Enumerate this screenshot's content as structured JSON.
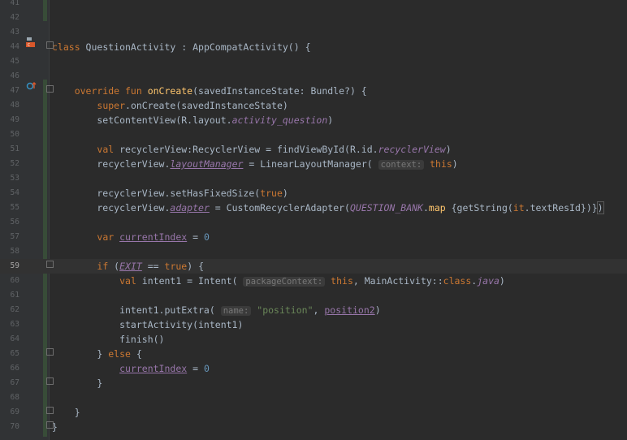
{
  "editor": {
    "lines": [
      {
        "n": "41",
        "tokens": []
      },
      {
        "n": "42",
        "tokens": []
      },
      {
        "n": "43",
        "tokens": []
      },
      {
        "n": "44",
        "tokens": [
          {
            "t": "class",
            "c": "kw"
          },
          {
            "t": " QuestionActivity : AppCompatActivity() {"
          }
        ]
      },
      {
        "n": "45",
        "tokens": []
      },
      {
        "n": "46",
        "tokens": []
      },
      {
        "n": "47",
        "tokens": [
          {
            "t": "    override fun ",
            "c": "kw"
          },
          {
            "t": "onCreate",
            "c": "fn"
          },
          {
            "t": "(savedInstanceState: Bundle?) {"
          }
        ]
      },
      {
        "n": "48",
        "tokens": [
          {
            "t": "        "
          },
          {
            "t": "super",
            "c": "kw"
          },
          {
            "t": ".onCreate(savedInstanceState)"
          }
        ]
      },
      {
        "n": "49",
        "tokens": [
          {
            "t": "        setContentView(R.layout."
          },
          {
            "t": "activity_question",
            "c": "pp"
          },
          {
            "t": ")"
          }
        ]
      },
      {
        "n": "50",
        "tokens": []
      },
      {
        "n": "51",
        "tokens": [
          {
            "t": "        "
          },
          {
            "t": "val ",
            "c": "kw"
          },
          {
            "t": "recyclerView:RecyclerView = findViewById(R.id."
          },
          {
            "t": "recyclerView",
            "c": "pp"
          },
          {
            "t": ")"
          }
        ]
      },
      {
        "n": "52",
        "tokens": [
          {
            "t": "        recyclerView."
          },
          {
            "t": "layoutManager",
            "c": "ppu"
          },
          {
            "t": " = LinearLayoutManager( "
          },
          {
            "t": "context:",
            "c": "hint"
          },
          {
            "t": " this",
            "c": "kw"
          },
          {
            "t": ")"
          }
        ]
      },
      {
        "n": "53",
        "tokens": []
      },
      {
        "n": "54",
        "tokens": [
          {
            "t": "        recyclerView.setHasFixedSize("
          },
          {
            "t": "true",
            "c": "kw"
          },
          {
            "t": ")"
          }
        ]
      },
      {
        "n": "55",
        "tokens": [
          {
            "t": "        recyclerView."
          },
          {
            "t": "adapter",
            "c": "ppu"
          },
          {
            "t": " = CustomRecyclerAdapter("
          },
          {
            "t": "QUESTION_BANK",
            "c": "pp"
          },
          {
            "t": "."
          },
          {
            "t": "map",
            "c": "fn"
          },
          {
            "t": " {getString("
          },
          {
            "t": "it",
            "c": "kw"
          },
          {
            "t": ".textResId})}"
          },
          {
            "t": ")",
            "c": "boxp"
          }
        ]
      },
      {
        "n": "56",
        "tokens": []
      },
      {
        "n": "57",
        "tokens": [
          {
            "t": "        "
          },
          {
            "t": "var ",
            "c": "kw"
          },
          {
            "t": "currentIndex",
            "c": "vu"
          },
          {
            "t": " = "
          },
          {
            "t": "0",
            "c": "num"
          }
        ]
      },
      {
        "n": "58",
        "tokens": []
      },
      {
        "n": "59",
        "tokens": [
          {
            "t": "        "
          },
          {
            "t": "if ",
            "c": "kw"
          },
          {
            "t": "("
          },
          {
            "t": "EXIT",
            "c": "ppu"
          },
          {
            "t": " == "
          },
          {
            "t": "true",
            "c": "kw"
          },
          {
            "t": ") {"
          }
        ],
        "current": true
      },
      {
        "n": "60",
        "tokens": [
          {
            "t": "            "
          },
          {
            "t": "val ",
            "c": "kw"
          },
          {
            "t": "intent1 = Intent( "
          },
          {
            "t": "packageContext:",
            "c": "hint"
          },
          {
            "t": " this",
            "c": "kw"
          },
          {
            "t": ", MainActivity::"
          },
          {
            "t": "class",
            "c": "kw"
          },
          {
            "t": "."
          },
          {
            "t": "java",
            "c": "pp"
          },
          {
            "t": ")"
          }
        ]
      },
      {
        "n": "61",
        "tokens": []
      },
      {
        "n": "62",
        "tokens": [
          {
            "t": "            intent1.putExtra( "
          },
          {
            "t": "name:",
            "c": "hint"
          },
          {
            "t": " "
          },
          {
            "t": "\"position\"",
            "c": "str"
          },
          {
            "t": ", "
          },
          {
            "t": "position2",
            "c": "vu"
          },
          {
            "t": ")"
          }
        ]
      },
      {
        "n": "63",
        "tokens": [
          {
            "t": "            startActivity(intent1)"
          }
        ]
      },
      {
        "n": "64",
        "tokens": [
          {
            "t": "            finish()"
          }
        ]
      },
      {
        "n": "65",
        "tokens": [
          {
            "t": "        } "
          },
          {
            "t": "else",
            "c": "kw"
          },
          {
            "t": " {"
          }
        ]
      },
      {
        "n": "66",
        "tokens": [
          {
            "t": "            "
          },
          {
            "t": "currentIndex",
            "c": "vu"
          },
          {
            "t": " = "
          },
          {
            "t": "0",
            "c": "num"
          }
        ]
      },
      {
        "n": "67",
        "tokens": [
          {
            "t": "        }"
          }
        ]
      },
      {
        "n": "68",
        "tokens": []
      },
      {
        "n": "69",
        "tokens": [
          {
            "t": "    }"
          }
        ]
      },
      {
        "n": "70",
        "tokens": [
          {
            "t": "}"
          }
        ]
      }
    ],
    "colors": {
      "background": "#2b2b2b",
      "keyword": "#cc7832",
      "function": "#ffc66d",
      "property": "#9876aa",
      "string": "#6a8759",
      "number": "#6897bb",
      "text": "#a9b7c6"
    },
    "gutter_icons": [
      {
        "line": "44",
        "icon": "activity-class-icon"
      },
      {
        "line": "47",
        "icon": "override-method-icon"
      }
    ]
  }
}
